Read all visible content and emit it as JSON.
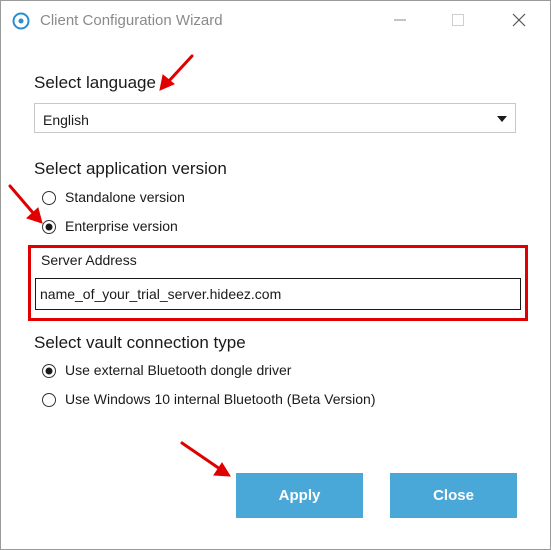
{
  "window": {
    "title": "Client Configuration Wizard"
  },
  "language": {
    "heading": "Select language",
    "selected": "English"
  },
  "version": {
    "heading": "Select application version",
    "options": [
      {
        "label": "Standalone version",
        "selected": false
      },
      {
        "label": "Enterprise version",
        "selected": true
      }
    ]
  },
  "server": {
    "label": "Server Address",
    "value": "name_of_your_trial_server.hideez.com"
  },
  "vault": {
    "heading": "Select vault connection type",
    "options": [
      {
        "label": "Use external Bluetooth dongle driver",
        "selected": true
      },
      {
        "label": "Use Windows 10 internal Bluetooth (Beta Version)",
        "selected": false
      }
    ]
  },
  "buttons": {
    "apply": "Apply",
    "close": "Close"
  },
  "colors": {
    "accent_button": "#4aa8d8",
    "annotation_red": "#e00000",
    "title_icon": "#2a8fd0"
  },
  "icons": {
    "app": "ring-icon",
    "minimize": "minimize-icon",
    "maximize": "maximize-icon",
    "close": "close-icon",
    "dropdown": "caret-down-icon"
  }
}
